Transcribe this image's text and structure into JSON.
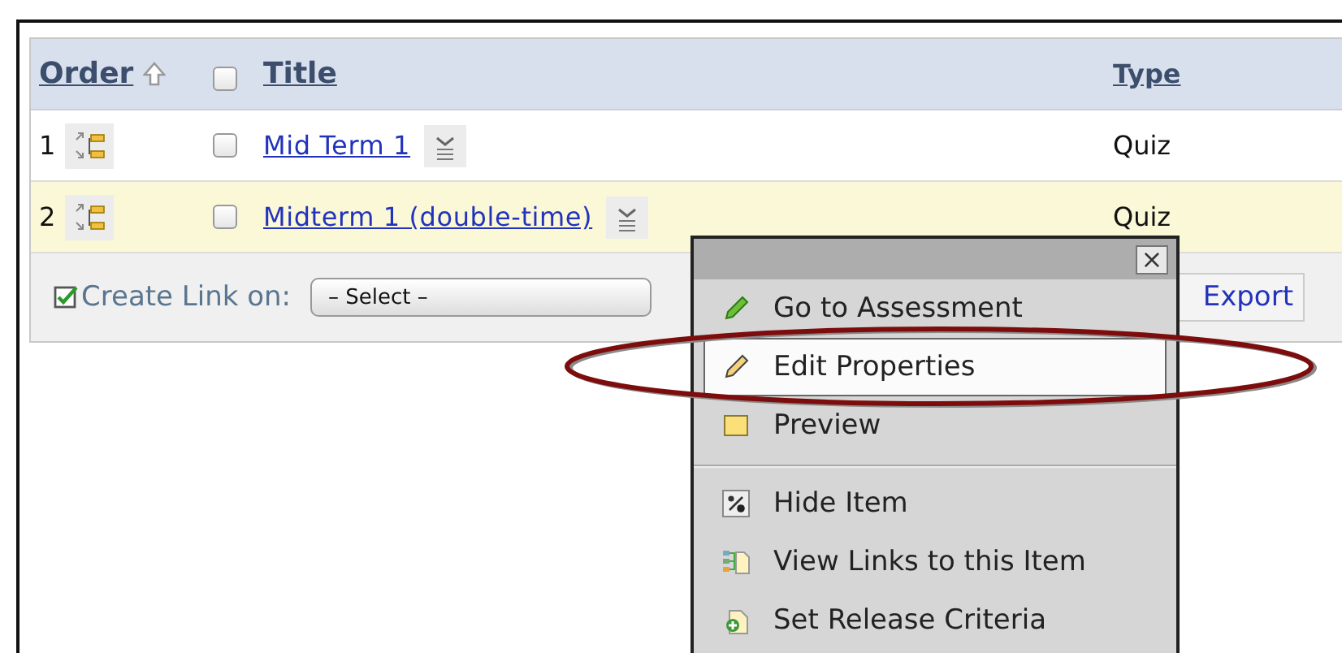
{
  "table": {
    "columns": [
      {
        "kind": "sort",
        "label": "Order",
        "sorted": true
      },
      {
        "kind": "checkbox",
        "checked": false
      },
      {
        "kind": "text",
        "label": "Title"
      },
      {
        "kind": "text",
        "label": "Type"
      }
    ],
    "rows": [
      {
        "order": "1",
        "checked": false,
        "title": "Mid Term 1",
        "type": "Quiz",
        "highlighted": false
      },
      {
        "order": "2",
        "checked": false,
        "title": "Midterm 1 (double-time)",
        "type": "Quiz",
        "highlighted": true
      }
    ]
  },
  "toolbar": {
    "label": "Create Link on:",
    "select": "– Select –",
    "export": "Export"
  },
  "context_menu": {
    "close": "×",
    "groups": [
      [
        {
          "kind": "go",
          "label": "Go to Assessment",
          "selected": false
        },
        {
          "kind": "edit",
          "label": "Edit Properties",
          "selected": true
        },
        {
          "kind": "preview",
          "label": "Preview",
          "selected": false
        }
      ],
      [
        {
          "kind": "hide",
          "label": "Hide Item",
          "selected": false
        },
        {
          "kind": "links",
          "label": "View Links to this Item",
          "selected": false
        },
        {
          "kind": "release",
          "label": "Set Release Criteria",
          "selected": false
        }
      ]
    ]
  }
}
